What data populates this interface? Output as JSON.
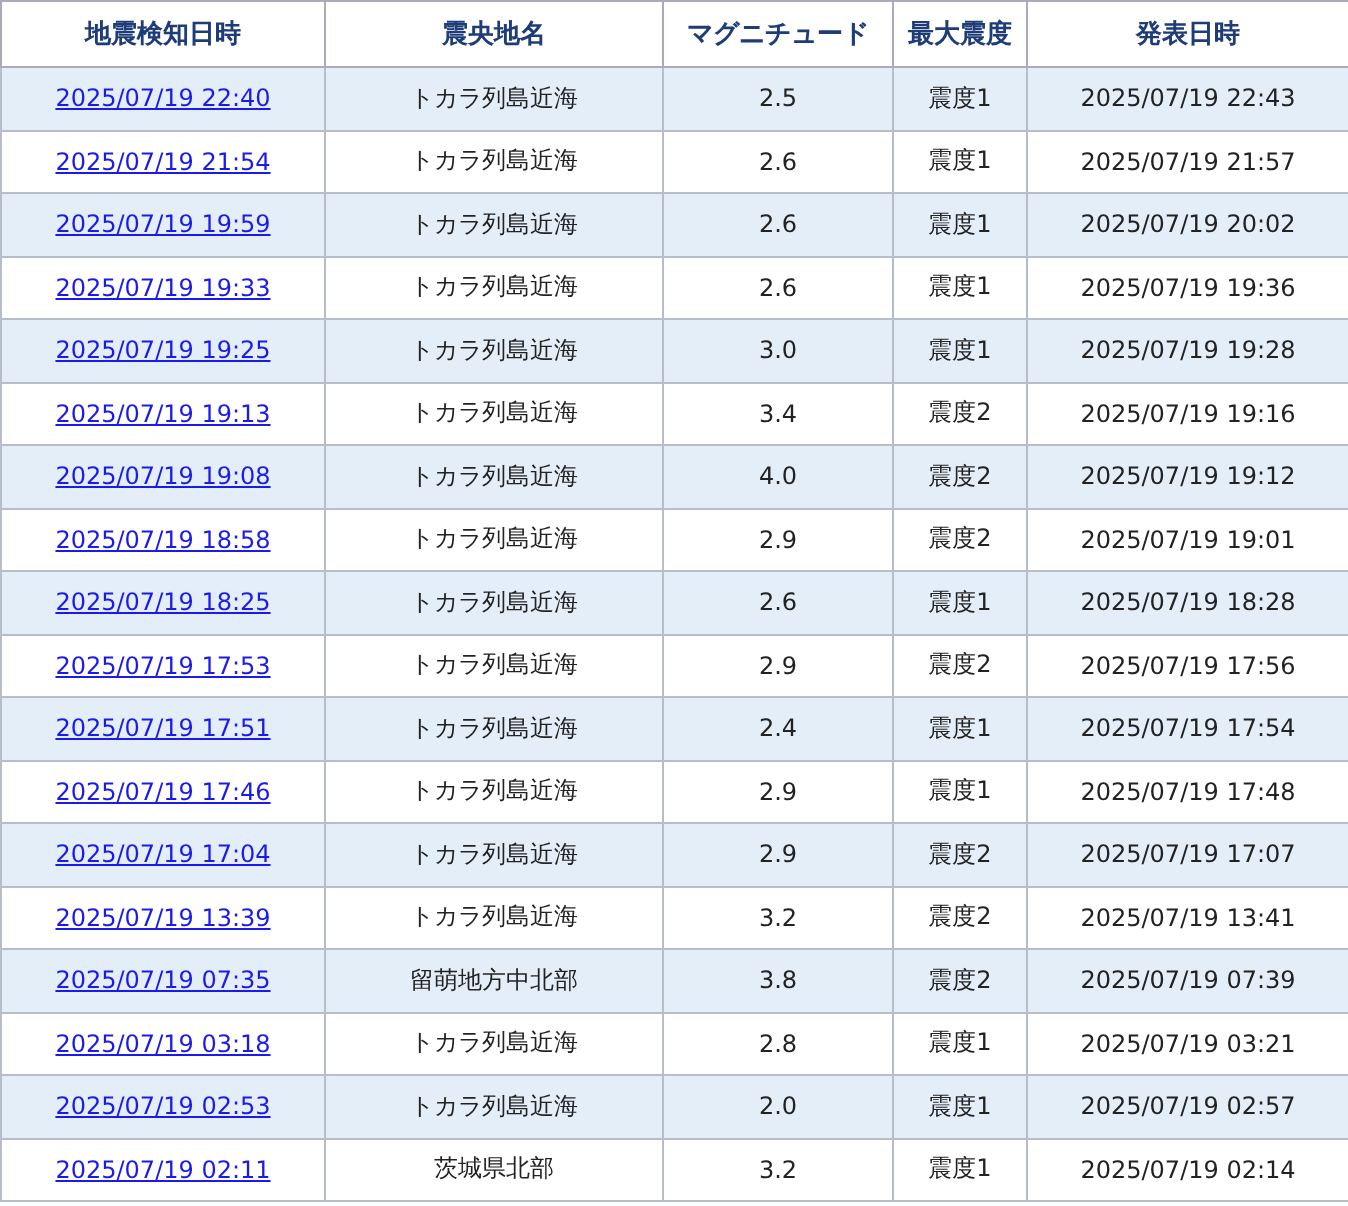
{
  "table": {
    "columns": [
      "地震検知日時",
      "震央地名",
      "マグニチュード",
      "最大震度",
      "発表日時"
    ],
    "rows": [
      {
        "detected": "2025/07/19 22:40",
        "epicenter": "トカラ列島近海",
        "magnitude": "2.5",
        "intensity": "震度1",
        "announced": "2025/07/19 22:43"
      },
      {
        "detected": "2025/07/19 21:54",
        "epicenter": "トカラ列島近海",
        "magnitude": "2.6",
        "intensity": "震度1",
        "announced": "2025/07/19 21:57"
      },
      {
        "detected": "2025/07/19 19:59",
        "epicenter": "トカラ列島近海",
        "magnitude": "2.6",
        "intensity": "震度1",
        "announced": "2025/07/19 20:02"
      },
      {
        "detected": "2025/07/19 19:33",
        "epicenter": "トカラ列島近海",
        "magnitude": "2.6",
        "intensity": "震度1",
        "announced": "2025/07/19 19:36"
      },
      {
        "detected": "2025/07/19 19:25",
        "epicenter": "トカラ列島近海",
        "magnitude": "3.0",
        "intensity": "震度1",
        "announced": "2025/07/19 19:28"
      },
      {
        "detected": "2025/07/19 19:13",
        "epicenter": "トカラ列島近海",
        "magnitude": "3.4",
        "intensity": "震度2",
        "announced": "2025/07/19 19:16"
      },
      {
        "detected": "2025/07/19 19:08",
        "epicenter": "トカラ列島近海",
        "magnitude": "4.0",
        "intensity": "震度2",
        "announced": "2025/07/19 19:12"
      },
      {
        "detected": "2025/07/19 18:58",
        "epicenter": "トカラ列島近海",
        "magnitude": "2.9",
        "intensity": "震度2",
        "announced": "2025/07/19 19:01"
      },
      {
        "detected": "2025/07/19 18:25",
        "epicenter": "トカラ列島近海",
        "magnitude": "2.6",
        "intensity": "震度1",
        "announced": "2025/07/19 18:28"
      },
      {
        "detected": "2025/07/19 17:53",
        "epicenter": "トカラ列島近海",
        "magnitude": "2.9",
        "intensity": "震度2",
        "announced": "2025/07/19 17:56"
      },
      {
        "detected": "2025/07/19 17:51",
        "epicenter": "トカラ列島近海",
        "magnitude": "2.4",
        "intensity": "震度1",
        "announced": "2025/07/19 17:54"
      },
      {
        "detected": "2025/07/19 17:46",
        "epicenter": "トカラ列島近海",
        "magnitude": "2.9",
        "intensity": "震度1",
        "announced": "2025/07/19 17:48"
      },
      {
        "detected": "2025/07/19 17:04",
        "epicenter": "トカラ列島近海",
        "magnitude": "2.9",
        "intensity": "震度2",
        "announced": "2025/07/19 17:07"
      },
      {
        "detected": "2025/07/19 13:39",
        "epicenter": "トカラ列島近海",
        "magnitude": "3.2",
        "intensity": "震度2",
        "announced": "2025/07/19 13:41"
      },
      {
        "detected": "2025/07/19 07:35",
        "epicenter": "留萌地方中北部",
        "magnitude": "3.8",
        "intensity": "震度2",
        "announced": "2025/07/19 07:39"
      },
      {
        "detected": "2025/07/19 03:18",
        "epicenter": "トカラ列島近海",
        "magnitude": "2.8",
        "intensity": "震度1",
        "announced": "2025/07/19 03:21"
      },
      {
        "detected": "2025/07/19 02:53",
        "epicenter": "トカラ列島近海",
        "magnitude": "2.0",
        "intensity": "震度1",
        "announced": "2025/07/19 02:57"
      },
      {
        "detected": "2025/07/19 02:11",
        "epicenter": "茨城県北部",
        "magnitude": "3.2",
        "intensity": "震度1",
        "announced": "2025/07/19 02:14"
      }
    ]
  }
}
